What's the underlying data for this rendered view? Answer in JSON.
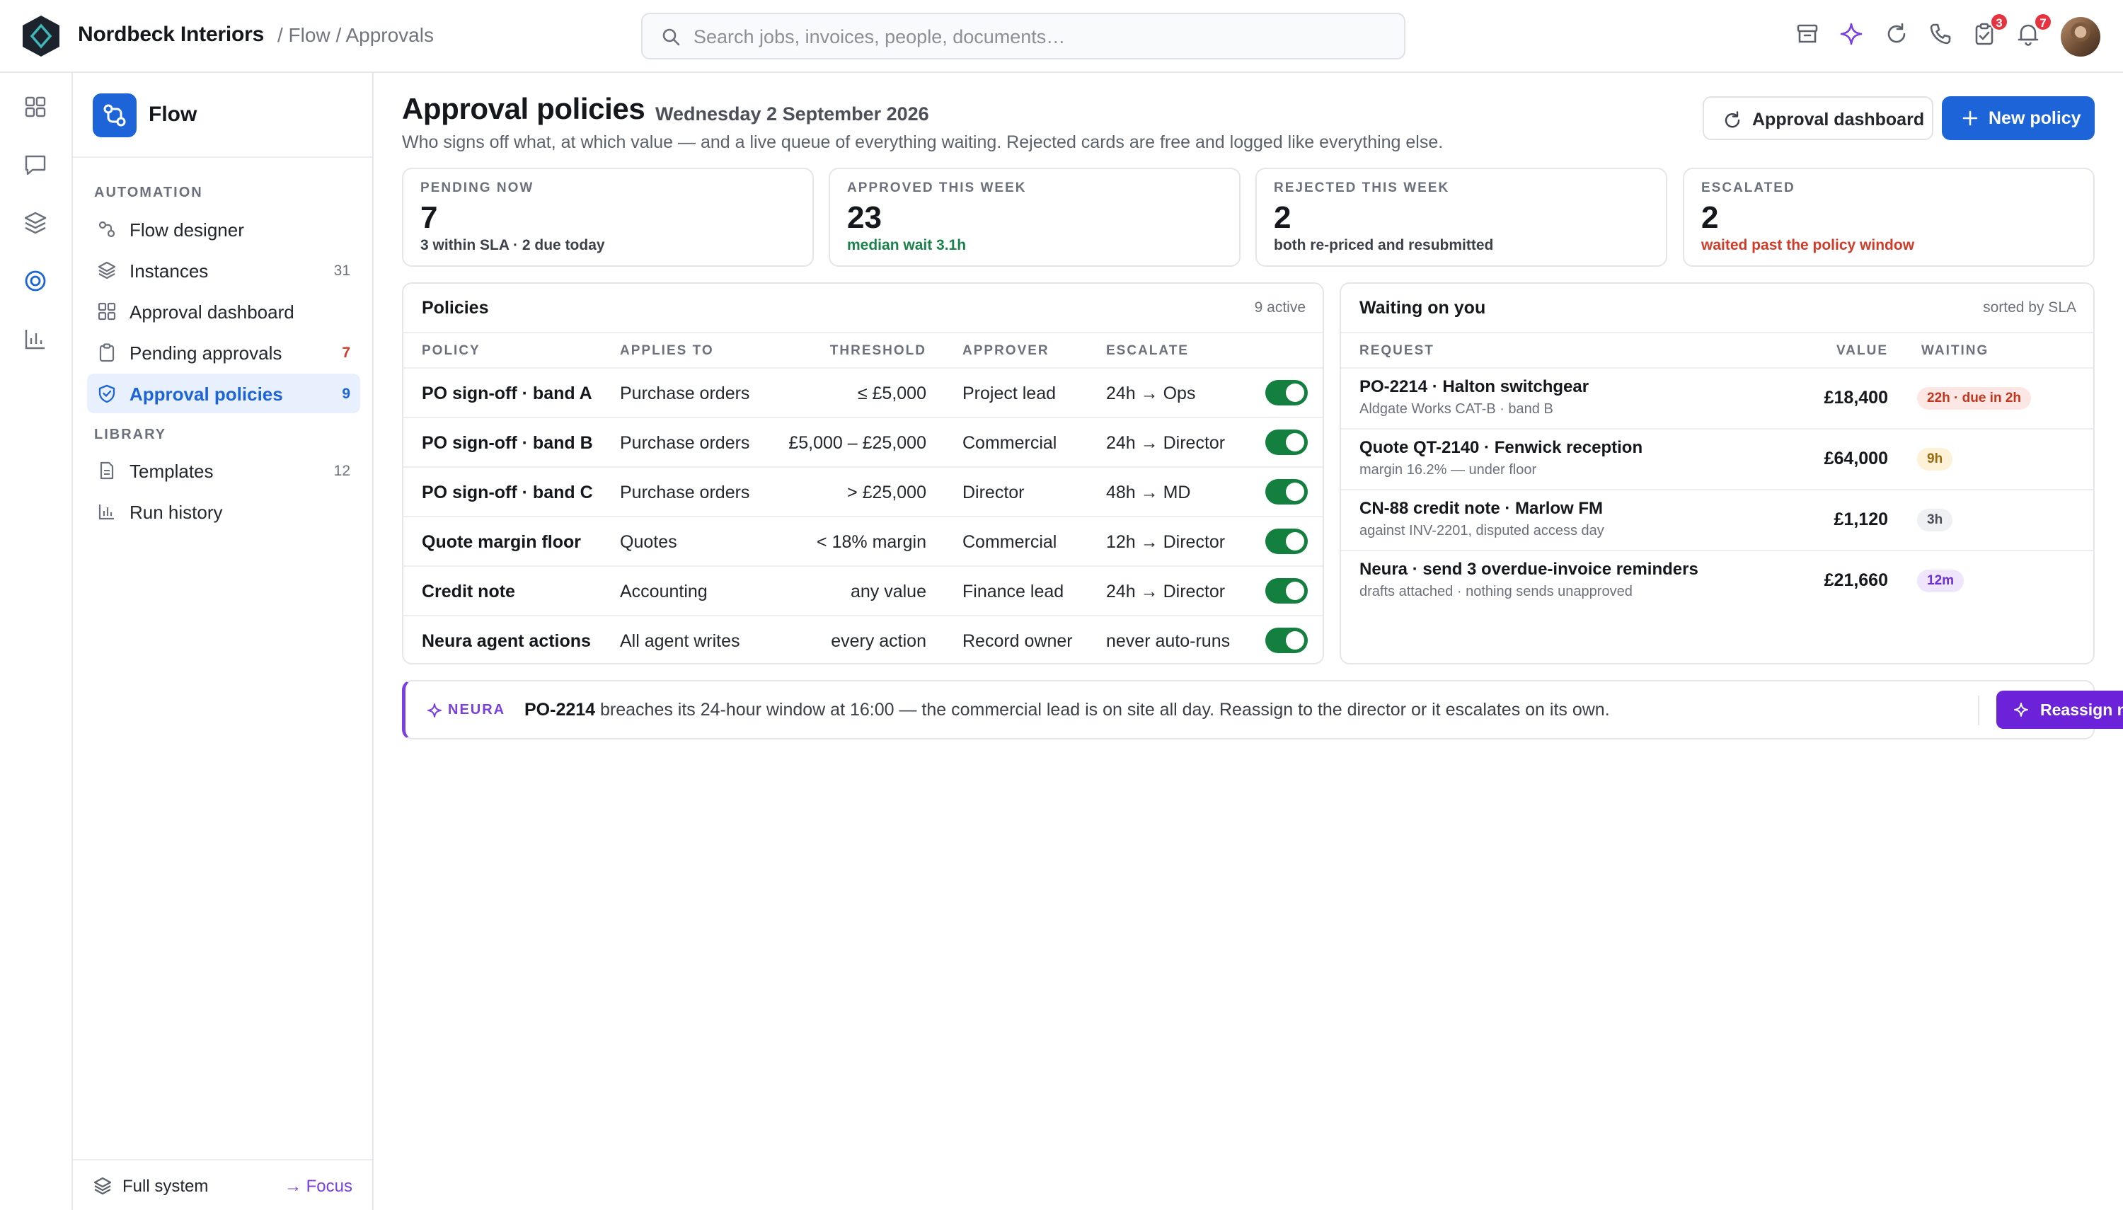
{
  "header": {
    "brand": "Nordbeck Interiors",
    "breadcrumb": "/ Flow / Approvals",
    "search_placeholder": "Search jobs, invoices, people, documents…",
    "icons": [
      "archive-icon",
      "sparkle-icon",
      "refresh-icon",
      "phone-icon",
      "clipboard-icon",
      "bell-icon"
    ],
    "badges": {
      "tasks": "3",
      "notifications": "7"
    }
  },
  "rail": {
    "icons": [
      "grid-icon",
      "chat-icon",
      "layers-icon",
      "target-icon",
      "chart-icon"
    ],
    "active": "target-icon"
  },
  "sidenav": {
    "app_name": "Flow",
    "sections": [
      {
        "title": "AUTOMATION",
        "items": [
          {
            "label": "Flow designer",
            "count": ""
          },
          {
            "label": "Instances",
            "count": "31"
          },
          {
            "label": "Approval dashboard",
            "count": ""
          },
          {
            "label": "Pending approvals",
            "count": "7"
          },
          {
            "label": "Approval policies",
            "count": "9"
          }
        ]
      },
      {
        "title": "LIBRARY",
        "items": [
          {
            "label": "Templates",
            "count": "12"
          },
          {
            "label": "Run history",
            "count": ""
          }
        ]
      }
    ],
    "footer": {
      "label": "Full system",
      "focus": "→ Focus"
    }
  },
  "page": {
    "title": "Approval policies",
    "date": "Wednesday 2 September 2026",
    "subtitle": "Who signs off what, at which value — and a live queue of everything waiting. Rejected cards are free and logged like everything else.",
    "dashboard_button": "Approval dashboard",
    "new_button": "New policy"
  },
  "stats": [
    {
      "label": "PENDING NOW",
      "value": "7",
      "note": "3 within SLA · 2 due today",
      "tone": "neutral"
    },
    {
      "label": "APPROVED THIS WEEK",
      "value": "23",
      "note": "median wait 3.1h",
      "tone": "green"
    },
    {
      "label": "REJECTED THIS WEEK",
      "value": "2",
      "note": "both re-priced and resubmitted",
      "tone": "neutral"
    },
    {
      "label": "ESCALATED",
      "value": "2",
      "note": "waited past the policy window",
      "tone": "red"
    }
  ],
  "policies": {
    "title": "Policies",
    "meta": "9 active",
    "columns": [
      "POLICY",
      "APPLIES TO",
      "THRESHOLD",
      "APPROVER",
      "ESCALATE"
    ],
    "rows": [
      {
        "policy": "PO sign-off · band A",
        "applies": "Purchase orders",
        "threshold": "≤ £5,000",
        "approver": "Project lead",
        "escalate": "24h → Ops",
        "enabled": true
      },
      {
        "policy": "PO sign-off · band B",
        "applies": "Purchase orders",
        "threshold": "£5,000 – £25,000",
        "approver": "Commercial",
        "escalate": "24h → Director",
        "enabled": true
      },
      {
        "policy": "PO sign-off · band C",
        "applies": "Purchase orders",
        "threshold": "> £25,000",
        "approver": "Director",
        "escalate": "48h → MD",
        "enabled": true
      },
      {
        "policy": "Quote margin floor",
        "applies": "Quotes",
        "threshold": "< 18% margin",
        "approver": "Commercial",
        "escalate": "12h → Director",
        "enabled": true
      },
      {
        "policy": "Credit note",
        "applies": "Accounting",
        "threshold": "any value",
        "approver": "Finance lead",
        "escalate": "24h → Director",
        "enabled": true
      },
      {
        "policy": "Neura agent actions",
        "applies": "All agent writes",
        "threshold": "every action",
        "approver": "Record owner",
        "escalate": "never auto-runs",
        "enabled": true
      }
    ]
  },
  "waiting": {
    "title": "Waiting on you",
    "meta": "sorted by SLA",
    "columns": [
      "REQUEST",
      "VALUE",
      "WAITING"
    ],
    "rows": [
      {
        "title": "PO-2214 · Halton switchgear",
        "sub": "Aldgate Works CAT-B · band B",
        "value": "£18,400",
        "waiting": "22h · due in 2h",
        "tone": "red"
      },
      {
        "title": "Quote QT-2140 · Fenwick reception",
        "sub": "margin 16.2% — under floor",
        "value": "£64,000",
        "waiting": "9h",
        "tone": "amber"
      },
      {
        "title": "CN-88 credit note · Marlow FM",
        "sub": "against INV-2201, disputed access day",
        "value": "£1,120",
        "waiting": "3h",
        "tone": "gray"
      },
      {
        "title": "Neura · send 3 overdue-invoice reminders",
        "sub": "drafts attached · nothing sends unapproved",
        "value": "£21,660",
        "waiting": "12m",
        "tone": "purple"
      }
    ]
  },
  "neura": {
    "tag": "NEURA",
    "ref": "PO-2214",
    "message": " breaches its 24-hour window at 16:00 — the commercial lead is on site all day. Reassign to the director or it escalates on its own.",
    "button": "Reassign now"
  },
  "colors": {
    "accent": "#1d64d8",
    "neura": "#7a3fe0",
    "toggle_on": "#13803f",
    "danger": "#d23b28",
    "success": "#19824a"
  }
}
